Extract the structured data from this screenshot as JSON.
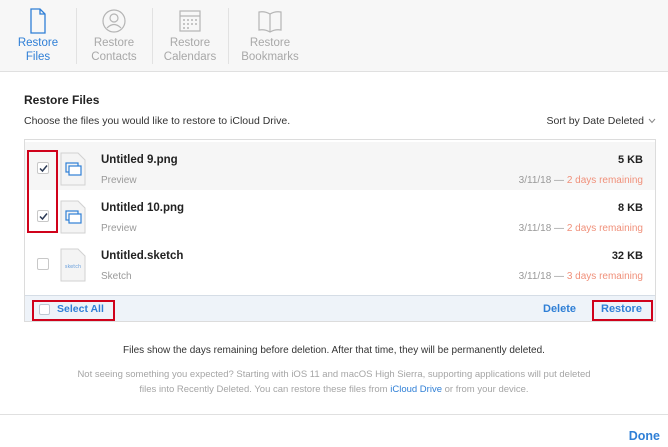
{
  "toolbar": {
    "items": [
      {
        "label_line1": "Restore",
        "label_line2": "Files",
        "icon": "document-icon",
        "active": true
      },
      {
        "label_line1": "Restore",
        "label_line2": "Contacts",
        "icon": "contact-icon",
        "active": false
      },
      {
        "label_line1": "Restore",
        "label_line2": "Calendars",
        "icon": "calendar-icon",
        "active": false
      },
      {
        "label_line1": "Restore",
        "label_line2": "Bookmarks",
        "icon": "book-icon",
        "active": false
      }
    ]
  },
  "section": {
    "title": "Restore Files",
    "description": "Choose the files you would like to restore to iCloud Drive.",
    "sort_label": "Sort by Date Deleted"
  },
  "files": [
    {
      "name": "Untitled 9.png",
      "kind": "Preview",
      "size": "5 KB",
      "date": "3/11/18 —",
      "remaining": "2 days remaining",
      "checked": true,
      "icon": "preview-file-icon"
    },
    {
      "name": "Untitled 10.png",
      "kind": "Preview",
      "size": "8 KB",
      "date": "3/11/18 —",
      "remaining": "2 days remaining",
      "checked": true,
      "icon": "preview-file-icon"
    },
    {
      "name": "Untitled.sketch",
      "kind": "Sketch",
      "size": "32 KB",
      "date": "3/11/18 —",
      "remaining": "3 days remaining",
      "checked": false,
      "icon": "sketch-file-icon",
      "icon_text": "sketch"
    }
  ],
  "actions": {
    "select_all": "Select All",
    "delete": "Delete",
    "restore": "Restore"
  },
  "notice": "Files show the days remaining before deletion. After that time, they will be permanently deleted.",
  "tip": {
    "line1": "Not seeing something you expected? Starting with iOS 11 and macOS High Sierra, supporting applications will put deleted",
    "line2_before": "files into Recently Deleted. You can restore these files from ",
    "link": "iCloud Drive",
    "line2_after": " or from your device."
  },
  "footer": {
    "done": "Done"
  },
  "colors": {
    "accent": "#2f7fd6",
    "remaining": "#f0907a",
    "annotation": "#d0021b"
  }
}
